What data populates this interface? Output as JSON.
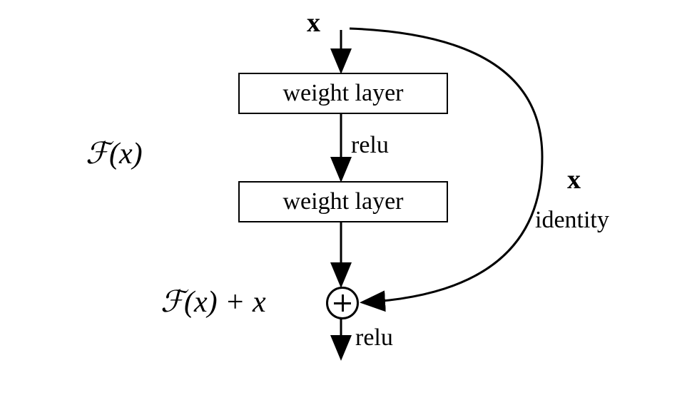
{
  "input_label": "x",
  "box1_label": "weight layer",
  "mid_activation": "relu",
  "box2_label": "weight layer",
  "fx_label": "ℱ(x)",
  "skip_x_label": "x",
  "skip_identity_label": "identity",
  "sum_label": "ℱ(x) + x",
  "out_activation": "relu"
}
